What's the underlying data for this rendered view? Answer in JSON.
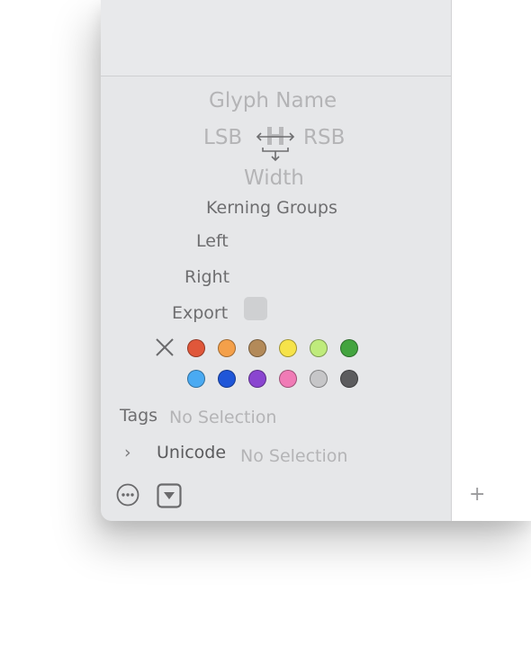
{
  "glyph": {
    "name_placeholder": "Glyph Name",
    "lsb_label": "LSB",
    "rsb_label": "RSB",
    "width_label": "Width",
    "metrics_icon": "metrics-h-icon"
  },
  "kerning": {
    "title": "Kerning Groups",
    "left_label": "Left",
    "right_label": "Right"
  },
  "export": {
    "label": "Export",
    "checked": false
  },
  "colors": {
    "clear_icon": "close-icon",
    "row1": [
      "#e0573a",
      "#f4a04a",
      "#b38a59",
      "#f6e34a",
      "#bfeb7c",
      "#43a43f"
    ],
    "row2": [
      "#4aaaf2",
      "#1f56d8",
      "#8a45d0",
      "#f07bb6",
      "#c6c6c8",
      "#5c5c5e"
    ]
  },
  "tags": {
    "label": "Tags",
    "value": "No Selection"
  },
  "unicode": {
    "chevron": "›",
    "label": "Unicode",
    "value": "No Selection"
  },
  "footer": {
    "more_icon": "ellipsis-circle-icon",
    "menu_icon": "dropdown-triangle-icon",
    "add_label": "+"
  }
}
